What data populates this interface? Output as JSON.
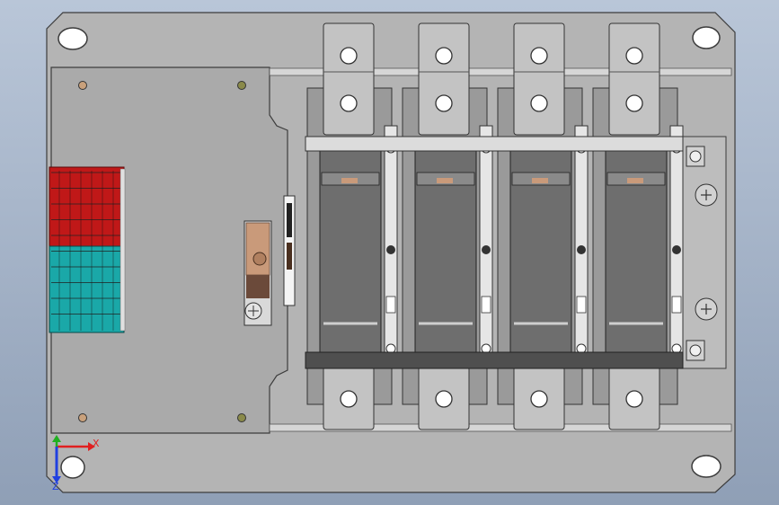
{
  "viewport": {
    "background_top": "#b9c6d8",
    "background_bottom": "#8f9fb6"
  },
  "colors": {
    "plate": "#b4b4b4",
    "plate_edge": "#3c3c3c",
    "panel": "#aaaaaa",
    "pole_dark": "#6e6e6e",
    "pole_frame": "#9a9a9a",
    "terminal": "#c3c3c3",
    "rail": "#d6d6d6",
    "red_terminals": "#c01818",
    "teal_terminals": "#1aa8a8",
    "screw": "#d2d2d2",
    "copper": "#c99a7a",
    "brown": "#6b4a3a",
    "axis_x": "#e02020",
    "axis_y": "#20b020",
    "axis_z": "#2040e0"
  },
  "model": {
    "poles": 4,
    "icons": [
      "mounting-hole-icon",
      "screw-icon",
      "terminal-block-icon",
      "pole-icon",
      "triad-icon"
    ]
  },
  "triad": {
    "x_label": "X",
    "z_label": "Z"
  }
}
